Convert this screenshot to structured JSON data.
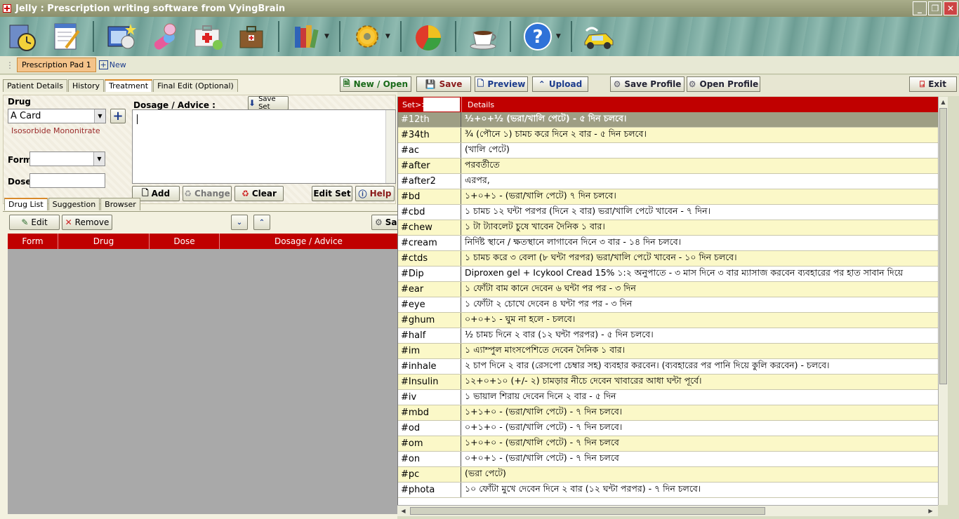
{
  "window": {
    "title": "Jelly : Prescription writing software from VyingBrain"
  },
  "toolbar": {
    "icons": [
      "clock-book-icon",
      "notepad-pen-icon",
      "photo-calendar-icon",
      "pills-icon",
      "medical-kit-icon",
      "briefcase-icon",
      "books-icon",
      "settings-gear-icon",
      "pie-chart-icon",
      "coffee-cup-icon",
      "help-icon",
      "car-icon"
    ]
  },
  "doc_tabs": {
    "active": "Prescription Pad 1",
    "new_label": "New"
  },
  "subtabs": [
    "Patient Details",
    "History",
    "Treatment",
    "Final Edit (Optional)"
  ],
  "form": {
    "drug_label": "Drug",
    "drug_value": "A Card",
    "drug_generic": "Isosorbide Mononitrate",
    "form_label": "Form",
    "dose_label": "Dose",
    "dosage_label": "Dosage / Advice :",
    "save_set": "Save Set",
    "add": "Add",
    "change": "Change",
    "clear": "Clear",
    "edit_set": "Edit Set",
    "help": "Help"
  },
  "list_tabs": [
    "Drug List",
    "Suggestion",
    "Browser"
  ],
  "list_actions": {
    "edit": "Edit",
    "remove": "Remove",
    "save_partial": "Sa"
  },
  "grid_columns": [
    "Form",
    "Drug",
    "Dose",
    "Dosage / Advice"
  ],
  "actions": {
    "new_open": "New / Open",
    "save": "Save",
    "preview": "Preview",
    "upload": "Upload",
    "save_profile": "Save Profile",
    "open_profile": "Open Profile",
    "exit": "Exit"
  },
  "set_table": {
    "headers": [
      "Set>>",
      "Details"
    ],
    "rows": [
      {
        "k": "#12th",
        "v": "½+০+½  (ভরা/খালি পেটে) - ৫ দিন চলবে।"
      },
      {
        "k": "#34th",
        "v": "¾ (পৌনে ১) চামচ করে দিনে ২ বার  -  ৫ দিন চলবে।"
      },
      {
        "k": "#ac",
        "v": "(খালি পেটে)"
      },
      {
        "k": "#after",
        "v": "পরবর্তীতে"
      },
      {
        "k": "#after2",
        "v": "এরপর,"
      },
      {
        "k": "#bd",
        "v": "১+০+১  - (ভরা/খালি পেটে) ৭ দিন চলবে।"
      },
      {
        "k": "#cbd",
        "v": "১ চামচ ১২ ঘন্টা পরপর (দিনে ২ বার) ভরা/খালি পেটে  খাবেন - ৭ দিন।"
      },
      {
        "k": "#chew",
        "v": "১ টা ট্যাবলেট চুষে খাবেন দৈনিক ১ বার।"
      },
      {
        "k": "#cream",
        "v": "নির্দিষ্ট স্থানে / ক্ষতস্থানে লাগাবেন দিনে ৩ বার - ১৪ দিন চলবে।"
      },
      {
        "k": "#ctds",
        "v": "১ চামচ করে ৩ বেলা (৮ ঘন্টা পরপর) ভরা/খালি পেটে খাবেন - ১০ দিন চলবে।"
      },
      {
        "k": "#Dip",
        "v": "Diproxen gel + Icykool Cread 15% ১:২ অনুপাতে - ৩ মাস দিনে ৩ বার ম্যাসাজ করবেন ব্যবহারের পর হাত সাবান দিয়ে"
      },
      {
        "k": "#ear",
        "v": "১ ফোঁটা বাম কানে দেবেন ৬ ঘন্টা পর পর - ৩ দিন"
      },
      {
        "k": "#eye",
        "v": "১ ফোঁটা ২ চোখে দেবেন ৪ ঘন্টা পর পর - ৩ দিন"
      },
      {
        "k": "#ghum",
        "v": "০+০+১  - ঘুম না হলে - চলবে।"
      },
      {
        "k": "#half",
        "v": "½ চামচ দিনে ২ বার (১২ ঘন্টা পরপর) -  ৫ দিন চলবে।"
      },
      {
        "k": "#im",
        "v": "১ এ্যাম্পুল মাংসপেশিতে দেবেন দৈনিক ১ বার।"
      },
      {
        "k": "#inhale",
        "v": "২ চাপ দিনে ২ বার (রেসপো চেম্বার সহ) ব্যবহার করবেন। (ব্যবহারের পর পানি দিয়ে কুলি করবেন) - চলবে।"
      },
      {
        "k": "#Insulin",
        "v": "১২+০+১০ (+/- ২) চামড়ার নীচে দেবেন খাবারের আধা ঘন্টা পূর্বে।"
      },
      {
        "k": "#iv",
        "v": "১ ভায়াল শিরায় দেবেন দিনে ২ বার - ৫ দিন"
      },
      {
        "k": "#mbd",
        "v": "১+১+০  - (ভরা/খালি পেটে) - ৭ দিন চলবে।"
      },
      {
        "k": "#od",
        "v": "০+১+০ - (ভরা/খালি পেটে) - ৭ দিন চলবে।"
      },
      {
        "k": "#om",
        "v": "১+০+০ - (ভরা/খালি পেটে) - ৭ দিন চলবে"
      },
      {
        "k": "#on",
        "v": "০+০+১ - (ভরা/খালি পেটে) - ৭ দিন চলবে"
      },
      {
        "k": "#pc",
        "v": "(ভরা পেটে)"
      },
      {
        "k": "#phota",
        "v": "১০ ফোঁটা মুখে দেবেন দিনে ২ বার (১২ ঘন্টা পরপর) - ৭ দিন চলবে।"
      }
    ]
  }
}
